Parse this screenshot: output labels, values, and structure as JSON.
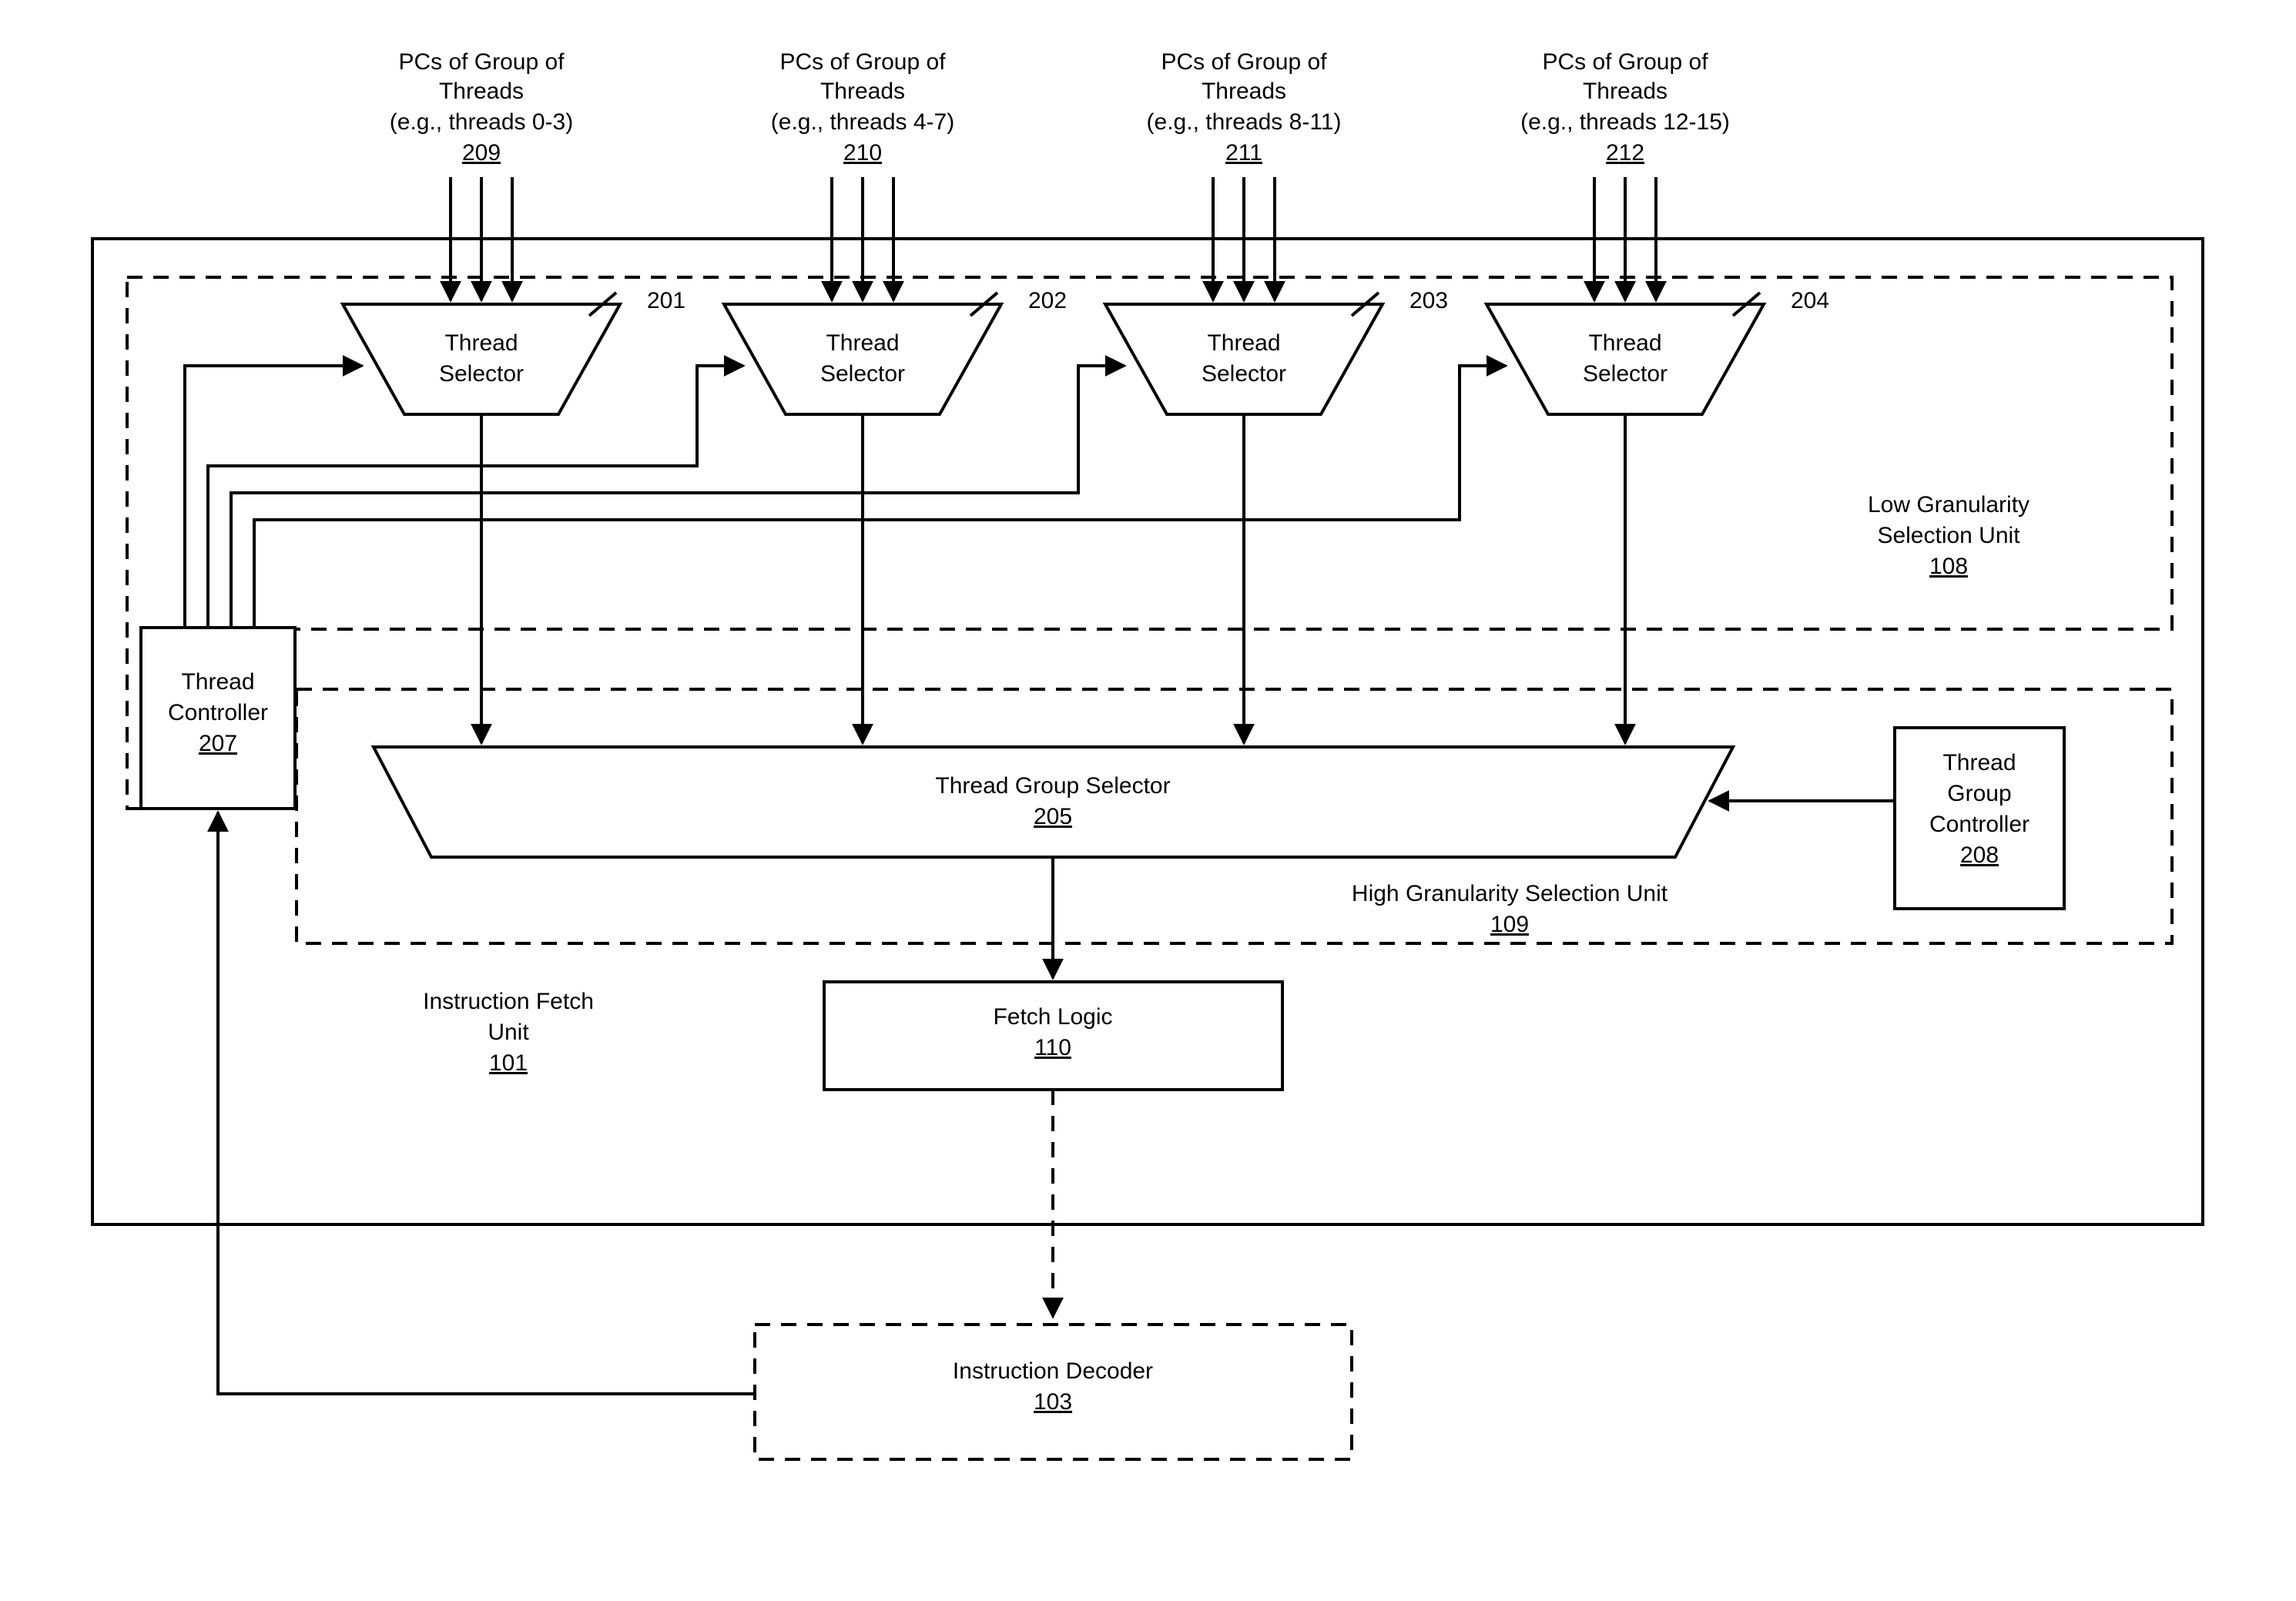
{
  "groups": [
    {
      "title_l1": "PCs of Group of",
      "title_l2": "Threads",
      "example": "(e.g., threads 0-3)",
      "ref": "209"
    },
    {
      "title_l1": "PCs of Group of",
      "title_l2": "Threads",
      "example": "(e.g., threads 4-7)",
      "ref": "210"
    },
    {
      "title_l1": "PCs of Group of",
      "title_l2": "Threads",
      "example": "(e.g., threads 8-11)",
      "ref": "211"
    },
    {
      "title_l1": "PCs of Group of",
      "title_l2": "Threads",
      "example": "(e.g., threads 12-15)",
      "ref": "212"
    }
  ],
  "thread_selectors": [
    {
      "label_l1": "Thread",
      "label_l2": "Selector",
      "tag": "201"
    },
    {
      "label_l1": "Thread",
      "label_l2": "Selector",
      "tag": "202"
    },
    {
      "label_l1": "Thread",
      "label_l2": "Selector",
      "tag": "203"
    },
    {
      "label_l1": "Thread",
      "label_l2": "Selector",
      "tag": "204"
    }
  ],
  "low_granularity": {
    "l1": "Low Granularity",
    "l2": "Selection Unit",
    "ref": "108"
  },
  "thread_controller": {
    "l1": "Thread",
    "l2": "Controller",
    "ref": "207"
  },
  "thread_group_selector": {
    "label": "Thread Group Selector",
    "ref": "205"
  },
  "high_granularity": {
    "l1": "High Granularity Selection Unit",
    "ref": "109"
  },
  "thread_group_controller": {
    "l1": "Thread",
    "l2": "Group",
    "l3": "Controller",
    "ref": "208"
  },
  "instruction_fetch_unit": {
    "l1": "Instruction Fetch",
    "l2": "Unit",
    "ref": "101"
  },
  "fetch_logic": {
    "label": "Fetch Logic",
    "ref": "110"
  },
  "instruction_decoder": {
    "label": "Instruction Decoder",
    "ref": "103"
  }
}
